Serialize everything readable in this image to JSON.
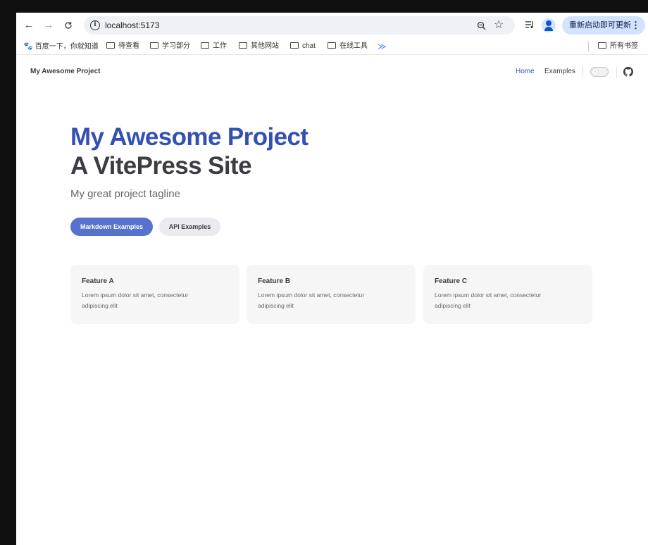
{
  "browser": {
    "url": "localhost:5173",
    "update_button": "重新启动即可更新",
    "bookmarks": [
      {
        "label": "百度一下，你就知道",
        "type": "site"
      },
      {
        "label": "待查看",
        "type": "folder"
      },
      {
        "label": "学习部分",
        "type": "folder"
      },
      {
        "label": "工作",
        "type": "folder"
      },
      {
        "label": "其他网站",
        "type": "folder"
      },
      {
        "label": "chat",
        "type": "folder"
      },
      {
        "label": "在线工具",
        "type": "folder"
      }
    ],
    "all_bookmarks": "所有书签",
    "icons": [
      "back-icon",
      "forward-icon",
      "reload-icon",
      "info-icon",
      "zoom-icon",
      "star-icon",
      "media-icon",
      "profile-icon",
      "menu-icon"
    ]
  },
  "site": {
    "brand": "My Awesome Project",
    "nav": {
      "home": "Home",
      "examples": "Examples"
    },
    "hero": {
      "name": "My Awesome Project",
      "text": "A VitePress Site",
      "tagline": "My great project tagline",
      "actions": {
        "primary": "Markdown Examples",
        "secondary": "API Examples"
      }
    },
    "features": [
      {
        "title": "Feature A",
        "details": "Lorem ipsum dolor sit amet, consectetur adipiscing elit"
      },
      {
        "title": "Feature B",
        "details": "Lorem ipsum dolor sit amet, consectetur adipiscing elit"
      },
      {
        "title": "Feature C",
        "details": "Lorem ipsum dolor sit amet, consectetur adipiscing elit"
      }
    ]
  },
  "colors": {
    "brand": "#3451b2",
    "brand_button": "#5672cd",
    "text": "#3c3c43",
    "muted": "#67676c",
    "feature_bg": "#f6f6f7"
  }
}
